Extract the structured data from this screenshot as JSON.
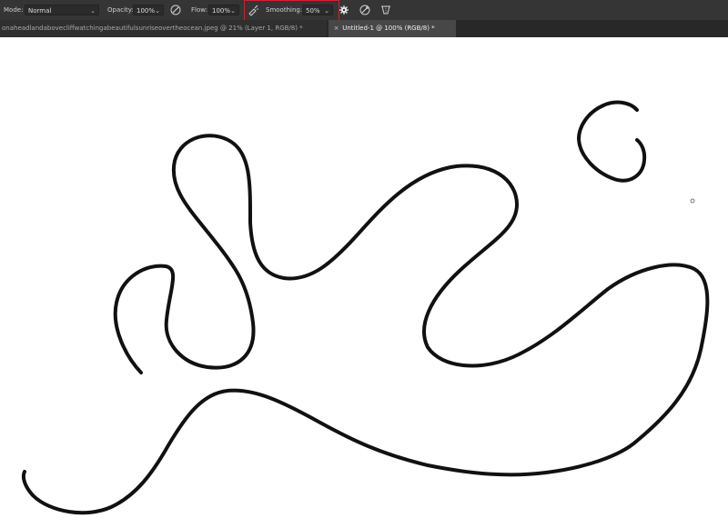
{
  "options_bar": {
    "mode_label": "Mode:",
    "mode_value": "Normal",
    "opacity_label": "Opacity:",
    "opacity_value": "100%",
    "flow_label": "Flow:",
    "flow_value": "100%",
    "smoothing_label": "Smoothing:",
    "smoothing_value": "50%",
    "icons": [
      "pressure-opacity-icon",
      "airbrush-icon",
      "smoothing-brush-icon",
      "gear-icon",
      "pressure-size-icon",
      "symmetry-icon"
    ]
  },
  "tabs": [
    {
      "title": "onaheadlandabovecliffwatchingabeautifulsunriseovertheocean.jpeg @ 21% (Layer 1, RGB/8) *",
      "active": false
    },
    {
      "title": "Untitled-1 @ 100% (RGB/8) *",
      "active": true
    }
  ],
  "colors": {
    "toolbar_bg": "#353535",
    "tabbar_bg": "#282828",
    "highlight": "#d4202b",
    "stroke": "#111111"
  }
}
